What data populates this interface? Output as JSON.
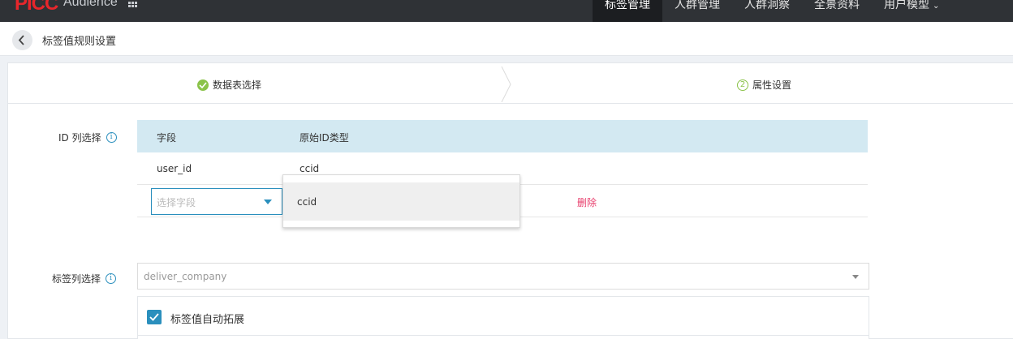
{
  "app": {
    "logo_text": "PICC",
    "name": "Audience",
    "grid_icon": "grid-icon"
  },
  "nav": {
    "items": [
      {
        "label": "标签管理",
        "active": true
      },
      {
        "label": "人群管理",
        "active": false
      },
      {
        "label": "人群洞察",
        "active": false
      },
      {
        "label": "全景资料",
        "active": false
      },
      {
        "label": "用户模型",
        "active": false,
        "has_dropdown": true
      }
    ]
  },
  "header": {
    "back_icon": "chevron-left-icon",
    "title": "标签值规则设置"
  },
  "steps": [
    {
      "label": "数据表选择",
      "status": "done",
      "icon": "check-circle-icon"
    },
    {
      "label": "属性设置",
      "status": "current",
      "number": "2"
    }
  ],
  "id_column": {
    "label": "ID 列选择",
    "info_icon": "i",
    "headers": [
      "字段",
      "原始ID类型"
    ],
    "rows": [
      {
        "field": "user_id",
        "id_type": "ccid"
      }
    ],
    "new_row": {
      "placeholder": "选择字段",
      "delete_label": "删除"
    },
    "dropdown_options": [
      "ccid"
    ]
  },
  "tag_column": {
    "label": "标签列选择",
    "info_icon": "i",
    "value": "deliver_company"
  },
  "auto_expand": {
    "label": "标签值自动拓展",
    "checked": true
  },
  "colors": {
    "topbar": "#2f3236",
    "brand_red": "#e8262b",
    "accent": "#2a8fbd",
    "success": "#8bc34a",
    "table_header": "#d3e9f2",
    "delete": "#e83e6c"
  }
}
